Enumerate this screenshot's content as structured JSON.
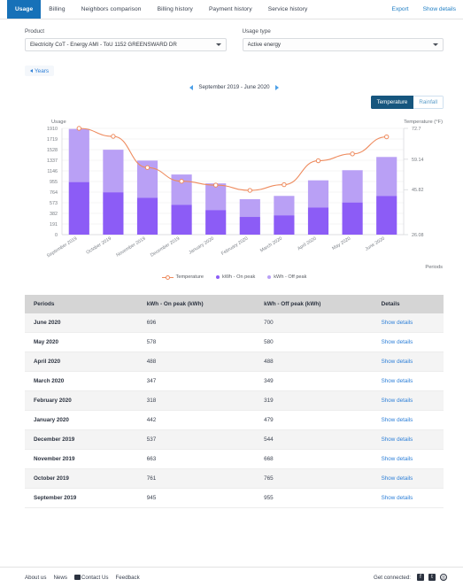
{
  "topnav": {
    "tabs": [
      {
        "label": "Usage",
        "active": true
      },
      {
        "label": "Billing",
        "active": false
      },
      {
        "label": "Neighbors comparison",
        "active": false
      },
      {
        "label": "Billing history",
        "active": false
      },
      {
        "label": "Payment history",
        "active": false
      },
      {
        "label": "Service history",
        "active": false
      }
    ],
    "links": [
      {
        "label": "Export"
      },
      {
        "label": "Show details"
      }
    ]
  },
  "filters": {
    "product": {
      "label": "Product",
      "value": "Electricity CoT - Energy AMI - ToU 1152 GREENSWARD DR"
    },
    "usage_type": {
      "label": "Usage type",
      "value": "Active energy"
    }
  },
  "years_button": {
    "label": "Years"
  },
  "pager": {
    "range": "September 2019 - June 2020"
  },
  "toggle": {
    "temperature": "Temperature",
    "rainfall": "Rainfall",
    "active": "Temperature"
  },
  "colors": {
    "accent_blue": "#1771b8",
    "link_blue": "#2f80d8",
    "on_peak": "#8c5cf6",
    "off_peak": "#b9a0f5",
    "temperature_line": "#ee8b5e",
    "toggle_active": "#16567e"
  },
  "chart_data": {
    "type": "bar",
    "title": "",
    "ylabel": "Usage",
    "y2label": "Temperature (°F)",
    "xlabel": "Periods",
    "grid": true,
    "legend_position": "bottom",
    "categories": [
      "September 2019",
      "October 2019",
      "November 2019",
      "December 2019",
      "January 2020",
      "February 2020",
      "March 2020",
      "April 2020",
      "May 2020",
      "June 2020"
    ],
    "series": [
      {
        "name": "kWh - On peak",
        "type": "bar",
        "color": "#8c5cf6",
        "values": [
          945,
          761,
          663,
          537,
          442,
          318,
          347,
          488,
          578,
          696
        ]
      },
      {
        "name": "kWh - Off peak",
        "type": "bar",
        "color": "#b9a0f5",
        "values": [
          955,
          765,
          668,
          544,
          479,
          319,
          349,
          488,
          580,
          700
        ]
      },
      {
        "name": "Temperature",
        "type": "line",
        "color": "#ee8b5e",
        "axis": "right",
        "values": [
          72.7,
          69.2,
          55.5,
          49.5,
          47.8,
          45.5,
          48.0,
          58.5,
          61.5,
          69.0
        ]
      }
    ],
    "ylim": [
      0,
      1910
    ],
    "yticks": [
      0,
      191,
      382,
      573,
      764,
      955,
      1146,
      1337,
      1528,
      1719,
      1910
    ],
    "ytick_labels": [
      "0",
      "191",
      "382",
      "573",
      "764",
      "955",
      "1146",
      "1337",
      "1528",
      "1719",
      "1910"
    ],
    "y2lim": [
      26.08,
      72.7
    ],
    "y2ticks": [
      26.08,
      45.82,
      59.14,
      72.7
    ],
    "y2tick_labels": [
      "26.08",
      "45.82",
      "59.14",
      "72.7"
    ]
  },
  "table": {
    "headers": [
      "Periods",
      "kWh - On peak (kWh)",
      "kWh - Off peak (kWh)",
      "Details"
    ],
    "detail_label": "Show details",
    "rows": [
      {
        "period": "June 2020",
        "on_peak": "696",
        "off_peak": "700"
      },
      {
        "period": "May 2020",
        "on_peak": "578",
        "off_peak": "580"
      },
      {
        "period": "April 2020",
        "on_peak": "488",
        "off_peak": "488"
      },
      {
        "period": "March 2020",
        "on_peak": "347",
        "off_peak": "349"
      },
      {
        "period": "February 2020",
        "on_peak": "318",
        "off_peak": "319"
      },
      {
        "period": "January 2020",
        "on_peak": "442",
        "off_peak": "479"
      },
      {
        "period": "December 2019",
        "on_peak": "537",
        "off_peak": "544"
      },
      {
        "period": "November 2019",
        "on_peak": "663",
        "off_peak": "668"
      },
      {
        "period": "October 2019",
        "on_peak": "761",
        "off_peak": "765"
      },
      {
        "period": "September 2019",
        "on_peak": "945",
        "off_peak": "955"
      }
    ]
  },
  "footer": {
    "links": [
      "About us",
      "News",
      "Contact Us",
      "Feedback"
    ],
    "get_connected": "Get connected:",
    "social": [
      "facebook-icon",
      "twitter-icon",
      "instagram-icon"
    ]
  }
}
